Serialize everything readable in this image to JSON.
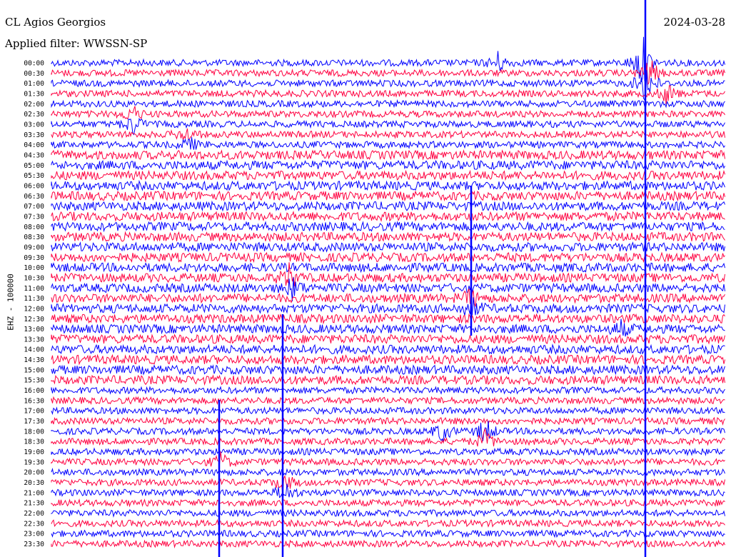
{
  "header": {
    "station": "CL Agios Georgios",
    "filter": "Applied filter: WWSSN-SP",
    "date": "2024-03-28"
  },
  "chart_data": {
    "type": "line",
    "ylabel": "EHZ - 100000",
    "row_labels": [
      "00:00",
      "00:30",
      "01:00",
      "01:30",
      "02:00",
      "02:30",
      "03:00",
      "03:30",
      "04:00",
      "04:30",
      "05:00",
      "05:30",
      "06:00",
      "06:30",
      "07:00",
      "07:30",
      "08:00",
      "08:30",
      "09:00",
      "09:30",
      "10:00",
      "10:30",
      "11:00",
      "11:30",
      "12:00",
      "12:30",
      "13:00",
      "13:30",
      "14:00",
      "14:30",
      "15:00",
      "15:30",
      "16:00",
      "16:30",
      "17:00",
      "17:30",
      "18:00",
      "18:30",
      "19:00",
      "19:30",
      "20:00",
      "20:30",
      "21:00",
      "21:30",
      "22:00",
      "22:30",
      "23:00",
      "23:30"
    ],
    "colors": [
      "#0000ff",
      "#ff0040"
    ],
    "grid": false
  }
}
